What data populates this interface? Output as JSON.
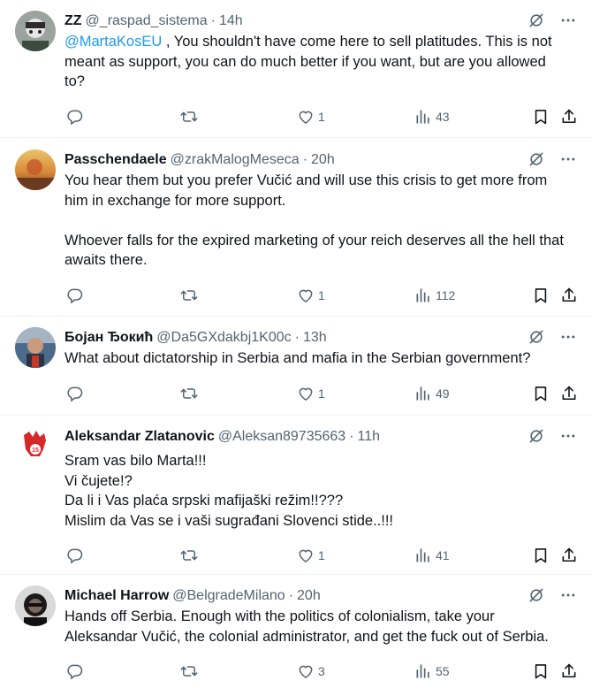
{
  "tweets": [
    {
      "name": "ZZ",
      "handle": "@_raspad_sistema",
      "time": "14h",
      "mention": "@MartaKosEU",
      "lines": [
        ", You shouldn't have come here to sell platitudes. This is not meant as support, you can do much better if you want, but are you allowed to?"
      ],
      "likes": "1",
      "views": "43"
    },
    {
      "name": "Passchendaele",
      "handle": "@zrakMalogMeseca",
      "time": "20h",
      "paragraphs": [
        "You hear them but you prefer Vučić and will use this crisis to get more from him in exchange for more support.",
        "Whoever falls for the expired marketing of your reich deserves all the hell that awaits there."
      ],
      "likes": "1",
      "views": "112"
    },
    {
      "name": "Бојан Ђокић",
      "handle": "@Da5GXdakbj1K00c",
      "time": "13h",
      "paragraphs": [
        "What about dictatorship in Serbia and mafia in the Serbian government?"
      ],
      "likes": "1",
      "views": "49"
    },
    {
      "name": "Aleksandar Zlatanovic",
      "handle": "@Aleksan89735663",
      "time": "11h",
      "lines": [
        "Sram vas bilo Marta!!!",
        "Vi čujete!?",
        "Da li i Vas plaća srpski mafijaški režim!!???",
        "Mislim da Vas se i vaši sugrađani Slovenci stide..!!!"
      ],
      "likes": "1",
      "views": "41"
    },
    {
      "name": "Michael Harrow",
      "handle": "@BelgradeMilano",
      "time": "20h",
      "paragraphs": [
        "Hands off Serbia. Enough with the politics of colonialism, take your Aleksandar Vučić, the colonial administrator, and get the fuck out of Serbia."
      ],
      "likes": "3",
      "views": "55"
    }
  ],
  "icons": {
    "reply": "reply-icon",
    "retweet": "retweet-icon",
    "like": "heart-icon",
    "views": "views-icon",
    "bookmark": "bookmark-icon",
    "share": "share-icon",
    "grok": "grok-icon",
    "more": "more-icon"
  },
  "colors": {
    "accent": "#1d9bf0",
    "muted": "#536471",
    "text": "#0f1419",
    "divider": "#eff3f4"
  }
}
